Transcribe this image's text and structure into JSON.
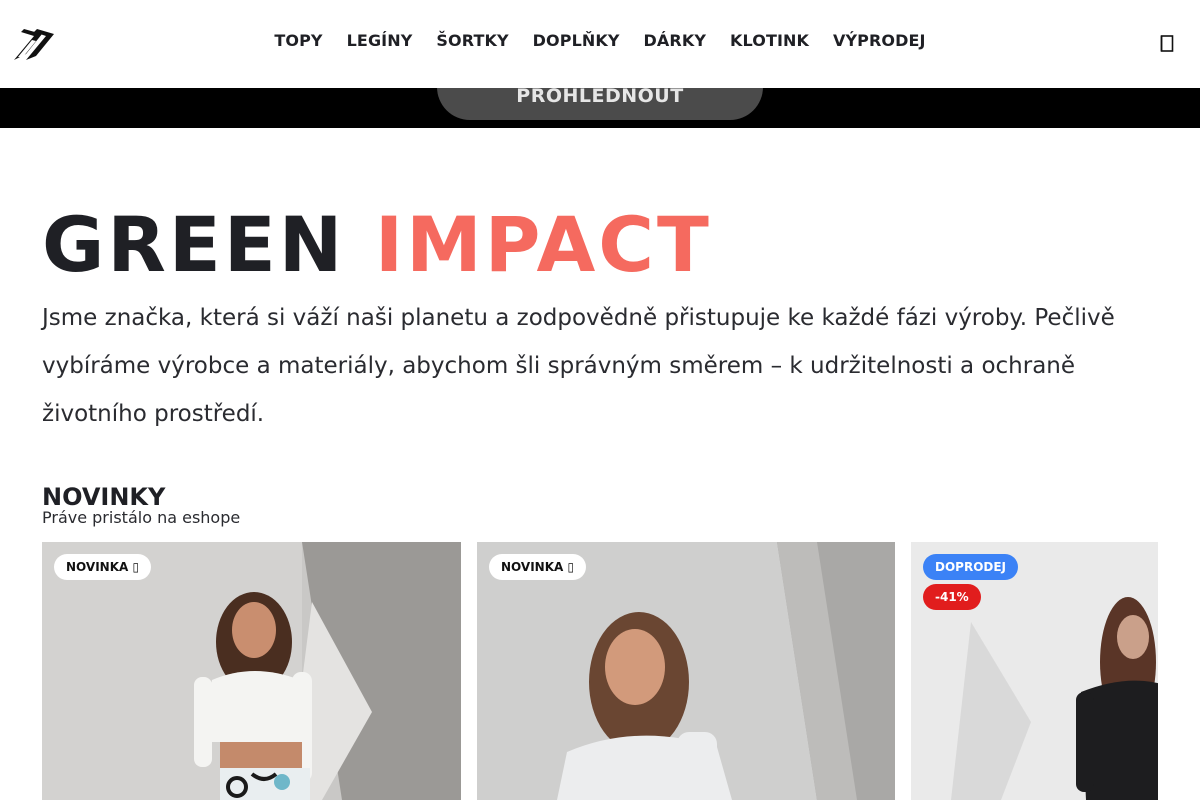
{
  "header": {
    "nav": [
      "TOPY",
      "LEGÍNY",
      "ŠORTKY",
      "DOPLŇKY",
      "DÁRKY",
      "KLOTINK",
      "VÝPRODEJ"
    ]
  },
  "hero": {
    "browse_label": "PROHLEDNOUT"
  },
  "green": {
    "word1": "GREEN",
    "word2": "IMPACT",
    "accent_color": "#f56a5f",
    "text": "Jsme značka, která si váží naši planetu a zodpovědně přistupuje ke každé fázi výroby. Pečlivě vybíráme výrobce a materiály, abychom šli správným směrem – k udržitelnosti a ochraně životního prostředí."
  },
  "new_section": {
    "title": "NOVINKY",
    "subtitle": "Práve pristálo na eshope",
    "products": [
      {
        "badges": [
          "NOVINKA ▯"
        ],
        "image": "model in white crop top and patterned leggings"
      },
      {
        "badges": [
          "NOVINKA ▯"
        ],
        "image": "model in white long-sleeve top"
      },
      {
        "badges": [
          "DOPRODEJ",
          "-41%"
        ],
        "image": "model in black zip top"
      }
    ],
    "badge_colors": {
      "sale": "#3b82f6",
      "discount": "#e11d1d"
    }
  }
}
